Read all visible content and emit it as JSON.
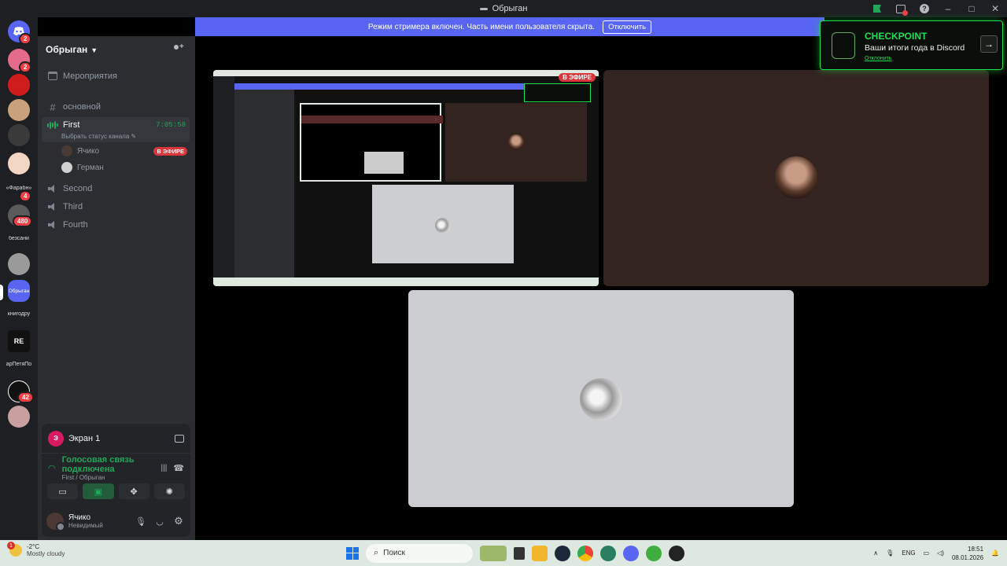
{
  "window": {
    "title": "Обрыган"
  },
  "stream_banner": {
    "text": "Режим стримера включен. Часть имени пользователя скрыта.",
    "disable_label": "Отключить"
  },
  "server_rail": {
    "items": [
      {
        "label": "",
        "badge": "2",
        "color": "#5865f2"
      },
      {
        "label": "",
        "badge": "2",
        "color": "#e56b8a"
      },
      {
        "label": "",
        "badge": "",
        "color": "#d01c1c"
      },
      {
        "label": "",
        "badge": "",
        "color": "#c8a27a"
      },
      {
        "label": "",
        "badge": "",
        "color": "#444"
      },
      {
        "label": "",
        "badge": "",
        "color": "#f1d6c4"
      },
      {
        "label": "«Фарабн»",
        "badge": "4",
        "color": ""
      },
      {
        "label": "",
        "badge": "480",
        "color": "#5a5a5a"
      },
      {
        "label": "безсани",
        "badge": "",
        "color": ""
      },
      {
        "label": "",
        "badge": "",
        "color": "#9a9a9a"
      },
      {
        "label": "Обрыган",
        "badge": "",
        "color": "#5865f2"
      },
      {
        "label": "книгодру",
        "badge": "",
        "color": ""
      },
      {
        "label": "",
        "badge": "",
        "color": "#111"
      },
      {
        "label": "арПетяПо",
        "badge": "",
        "color": ""
      },
      {
        "label": "",
        "badge": "42",
        "color": "#111"
      },
      {
        "label": "",
        "badge": "",
        "color": "#c9a0a0"
      }
    ]
  },
  "guild": {
    "name": "Обрыган"
  },
  "channels": {
    "events_label": "Мероприятия",
    "text_channel": "основной",
    "voice_active": {
      "name": "First",
      "time": "7:05:58",
      "status_hint": "Выбрать статус канала"
    },
    "members": [
      {
        "name": "Ячико",
        "live": "В ЭФИРЕ"
      },
      {
        "name": "Герман",
        "live": ""
      }
    ],
    "voice_others": [
      "Second",
      "Third",
      "Fourth"
    ]
  },
  "panel": {
    "screen_title": "Экран 1",
    "voice_status": "Голосовая связь подключена",
    "voice_location": "First / Обрыган",
    "user_name": "Ячико",
    "user_status": "Невидимый"
  },
  "stage": {
    "live_label": "В ЭФИРЕ"
  },
  "checkpoint": {
    "title": "CHECKPOINT",
    "subtitle": "Ваши итоги года в Discord",
    "dismiss": "Отклонить"
  },
  "taskbar": {
    "temperature": "-2°C",
    "weather": "Mostly cloudy",
    "weather_badge": "1",
    "search_placeholder": "Поиск",
    "language": "ENG",
    "time": "18:51",
    "date": "08.01.2026"
  },
  "icons": {
    "discord_home": "discord-icon",
    "add_member": "add-user-icon",
    "signal": "signal-icon",
    "disconnect": "phone-hangup-icon",
    "mic": "mic-icon",
    "headphones": "headphones-icon",
    "settings": "gear-icon"
  }
}
